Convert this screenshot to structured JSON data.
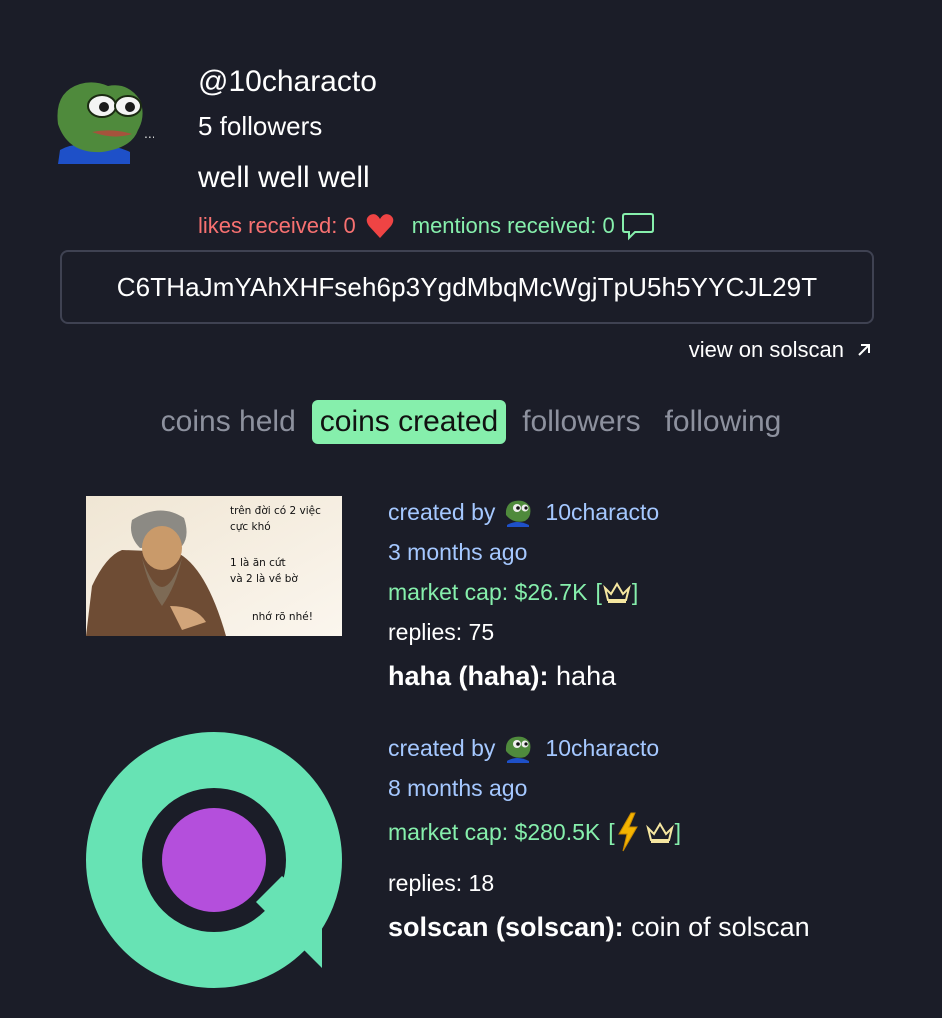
{
  "profile": {
    "username": "@10characto",
    "followers": "5 followers",
    "bio": "well well well",
    "likes_label": "likes received: 0",
    "mentions_label": "mentions received: 0",
    "avatar_dots": "..."
  },
  "address": "C6THaJmYAhXHFseh6p3YgdMbqMcWgjTpU5h5YYCJL29T",
  "solscan_link": "view on solscan",
  "tabs": [
    {
      "label": "coins held",
      "active": false
    },
    {
      "label": "coins created",
      "active": true
    },
    {
      "label": "followers",
      "active": false
    },
    {
      "label": "following",
      "active": false
    }
  ],
  "coins": [
    {
      "created_by_label": "created by",
      "creator": "10characto",
      "age": "3 months ago",
      "market_cap": "market cap: $26.7K",
      "badges": [
        "crown-icon"
      ],
      "replies": "replies: 75",
      "name": "haha (haha):",
      "description": "haha",
      "image_text": {
        "line1": "trên đời có 2 việc",
        "line2": "cực khó",
        "line3": "1 là ăn cứt",
        "line4": "và 2 là về bờ",
        "line5": "nhớ rõ nhé!"
      }
    },
    {
      "created_by_label": "created by",
      "creator": "10characto",
      "age": "8 months ago",
      "market_cap": "market cap: $280.5K",
      "badges": [
        "lightning-icon",
        "crown-icon"
      ],
      "replies": "replies: 18",
      "name": "solscan (solscan):",
      "description": "coin of solscan"
    }
  ],
  "colors": {
    "background": "#1b1d28",
    "accent_green": "#86efac",
    "likes_red": "#f87171",
    "link_blue": "#a5c8ff",
    "solscan_teal": "#67e3b4",
    "solscan_purple": "#b44fdc"
  }
}
